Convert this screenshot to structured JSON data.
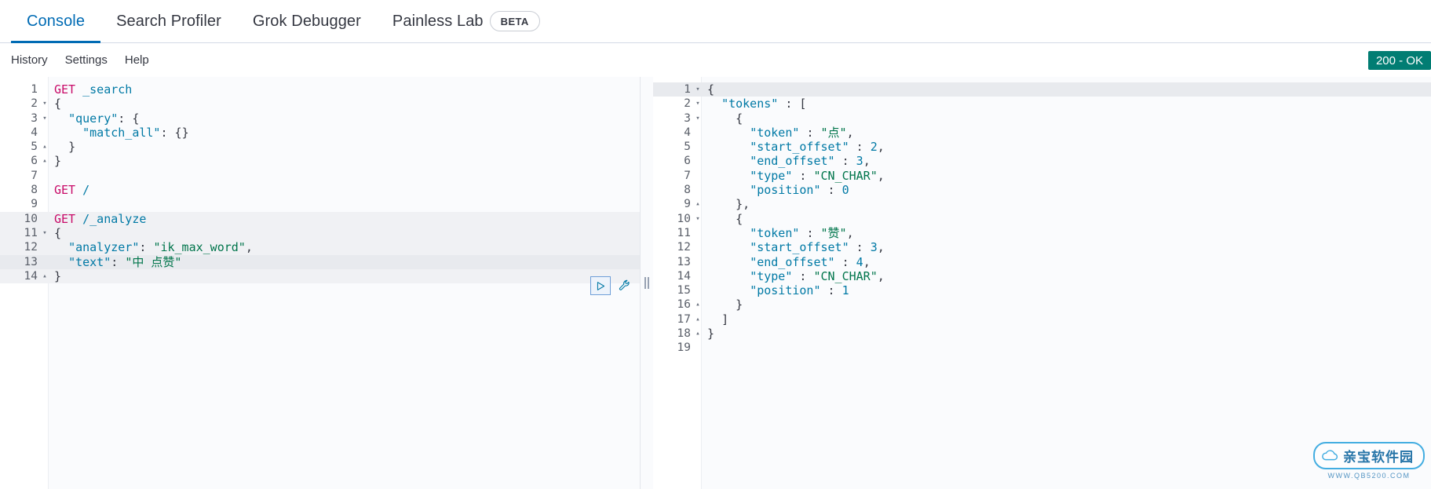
{
  "tabs": [
    {
      "label": "Console",
      "active": true
    },
    {
      "label": "Search Profiler",
      "active": false
    },
    {
      "label": "Grok Debugger",
      "active": false
    },
    {
      "label": "Painless Lab",
      "active": false
    }
  ],
  "beta_badge": "BETA",
  "subnav": [
    {
      "label": "History"
    },
    {
      "label": "Settings"
    },
    {
      "label": "Help"
    }
  ],
  "status": {
    "text": "200 - OK",
    "color": "#017d73"
  },
  "editor": {
    "lines": [
      {
        "n": "1",
        "fold": "",
        "text": "GET _search"
      },
      {
        "n": "2",
        "fold": "▾",
        "text": "{"
      },
      {
        "n": "3",
        "fold": "▾",
        "text": "  \"query\": {"
      },
      {
        "n": "4",
        "fold": "",
        "text": "    \"match_all\": {}"
      },
      {
        "n": "5",
        "fold": "▴",
        "text": "  }"
      },
      {
        "n": "6",
        "fold": "▴",
        "text": "}"
      },
      {
        "n": "7",
        "fold": "",
        "text": ""
      },
      {
        "n": "8",
        "fold": "",
        "text": "GET /"
      },
      {
        "n": "9",
        "fold": "",
        "text": ""
      },
      {
        "n": "10",
        "fold": "",
        "text": "GET /_analyze"
      },
      {
        "n": "11",
        "fold": "▾",
        "text": "{"
      },
      {
        "n": "12",
        "fold": "",
        "text": "  \"analyzer\": \"ik_max_word\","
      },
      {
        "n": "13",
        "fold": "",
        "text": "  \"text\": \"中 点赞\""
      },
      {
        "n": "14",
        "fold": "▴",
        "text": "}"
      }
    ],
    "cursor_line": "13",
    "active_request_lines": [
      "10",
      "11",
      "12",
      "13",
      "14"
    ]
  },
  "response": {
    "lines": [
      {
        "n": "1",
        "fold": "▾",
        "text": "{"
      },
      {
        "n": "2",
        "fold": "▾",
        "text": "  \"tokens\" : ["
      },
      {
        "n": "3",
        "fold": "▾",
        "text": "    {"
      },
      {
        "n": "4",
        "fold": "",
        "text": "      \"token\" : \"点\","
      },
      {
        "n": "5",
        "fold": "",
        "text": "      \"start_offset\" : 2,"
      },
      {
        "n": "6",
        "fold": "",
        "text": "      \"end_offset\" : 3,"
      },
      {
        "n": "7",
        "fold": "",
        "text": "      \"type\" : \"CN_CHAR\","
      },
      {
        "n": "8",
        "fold": "",
        "text": "      \"position\" : 0"
      },
      {
        "n": "9",
        "fold": "▴",
        "text": "    },"
      },
      {
        "n": "10",
        "fold": "▾",
        "text": "    {"
      },
      {
        "n": "11",
        "fold": "",
        "text": "      \"token\" : \"赞\","
      },
      {
        "n": "12",
        "fold": "",
        "text": "      \"start_offset\" : 3,"
      },
      {
        "n": "13",
        "fold": "",
        "text": "      \"end_offset\" : 4,"
      },
      {
        "n": "14",
        "fold": "",
        "text": "      \"type\" : \"CN_CHAR\","
      },
      {
        "n": "15",
        "fold": "",
        "text": "      \"position\" : 1"
      },
      {
        "n": "16",
        "fold": "▴",
        "text": "    }"
      },
      {
        "n": "17",
        "fold": "▴",
        "text": "  ]"
      },
      {
        "n": "18",
        "fold": "▴",
        "text": "}"
      },
      {
        "n": "19",
        "fold": "",
        "text": ""
      }
    ]
  },
  "controls": {
    "play_label": "send-request",
    "wrench_label": "request-options"
  },
  "watermark": {
    "title": "亲宝软件园",
    "subtitle": "WWW.QB5200.COM"
  }
}
